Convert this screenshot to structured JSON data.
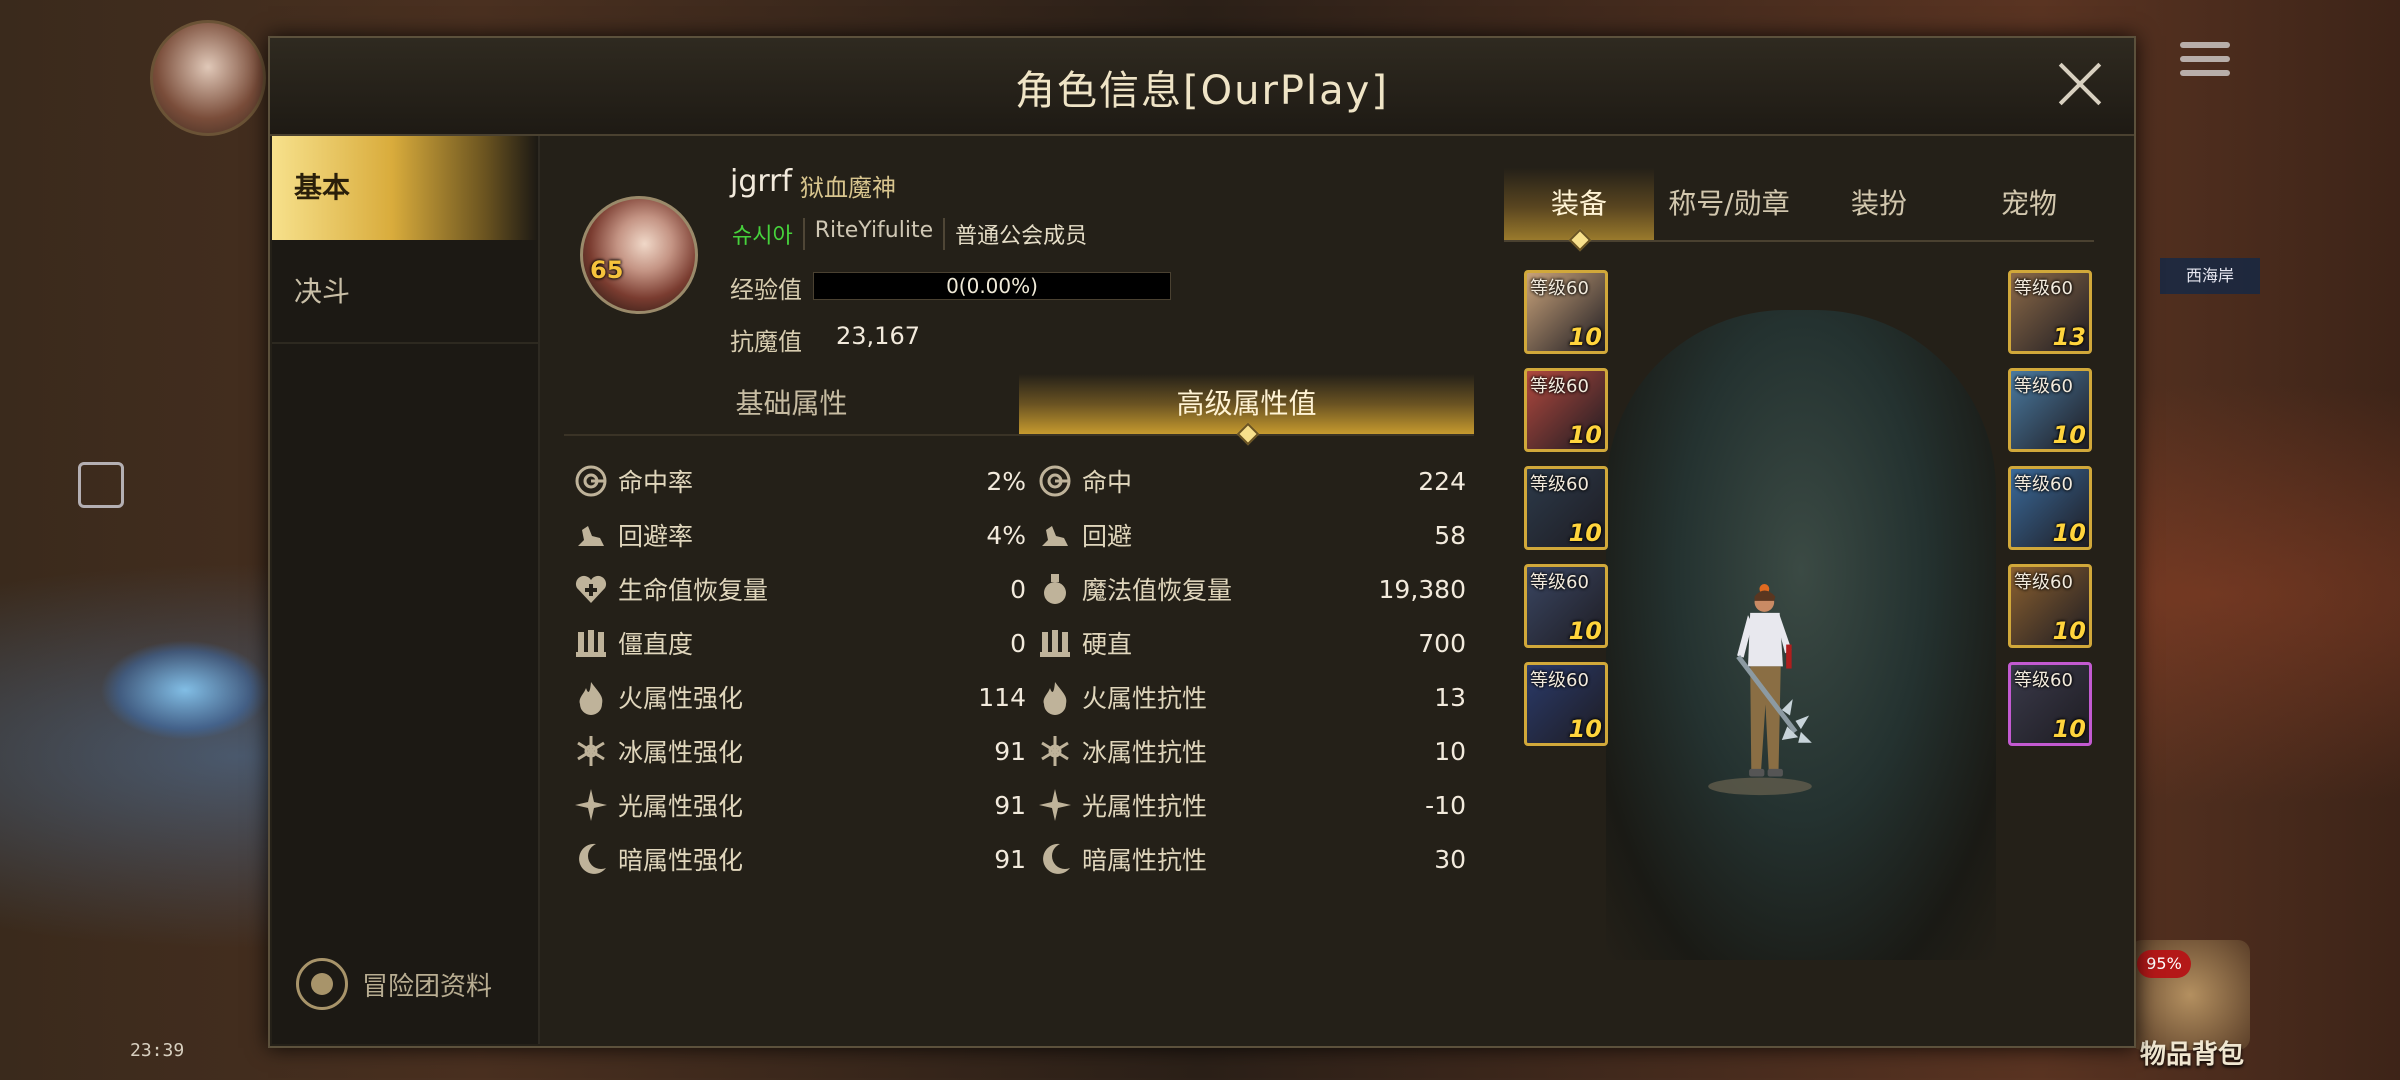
{
  "background": {
    "status_time": "23:39",
    "sidebox_label": "西海岸",
    "bag_badge": "95%",
    "bag_label": "物品背包"
  },
  "window": {
    "title": "角色信息[OurPlay]"
  },
  "nav": {
    "items": [
      {
        "label": "基本",
        "active": true
      },
      {
        "label": "决斗",
        "active": false
      }
    ],
    "adventure_label": "冒险团资料"
  },
  "character": {
    "level": "65",
    "name": "jgrrf",
    "class_name": "狱血魔神",
    "server": "슈시아",
    "guild": "RiteYifulite",
    "guild_rank": "普通公会成员",
    "exp_label": "经验值",
    "exp_value": "0(0.00%)",
    "exp_fraction": 0.0,
    "magic_resist_label": "抗魔值",
    "magic_resist_value": "23,167"
  },
  "attribute_tabs": [
    {
      "label": "基础属性",
      "active": false
    },
    {
      "label": "高级属性值",
      "active": true
    }
  ],
  "stats": [
    {
      "left": {
        "icon": "target-icon",
        "label": "命中率",
        "value": "2%"
      },
      "right": {
        "icon": "target-icon",
        "label": "命中",
        "value": "224"
      }
    },
    {
      "left": {
        "icon": "dodge-icon",
        "label": "回避率",
        "value": "4%"
      },
      "right": {
        "icon": "dodge-icon",
        "label": "回避",
        "value": "58"
      }
    },
    {
      "left": {
        "icon": "heart-icon",
        "label": "生命值恢复量",
        "value": "0"
      },
      "right": {
        "icon": "potion-icon",
        "label": "魔法值恢复量",
        "value": "19,380"
      }
    },
    {
      "left": {
        "icon": "stiff-icon",
        "label": "僵直度",
        "value": "0"
      },
      "right": {
        "icon": "stiff-icon",
        "label": "硬直",
        "value": "700"
      }
    },
    {
      "left": {
        "icon": "fire-icon",
        "label": "火属性强化",
        "value": "114"
      },
      "right": {
        "icon": "fire-icon",
        "label": "火属性抗性",
        "value": "13"
      }
    },
    {
      "left": {
        "icon": "snowflake-icon",
        "label": "冰属性强化",
        "value": "91"
      },
      "right": {
        "icon": "snowflake-icon",
        "label": "冰属性抗性",
        "value": "10"
      }
    },
    {
      "left": {
        "icon": "light-icon",
        "label": "光属性强化",
        "value": "91"
      },
      "right": {
        "icon": "light-icon",
        "label": "光属性抗性",
        "value": "-10"
      }
    },
    {
      "left": {
        "icon": "moon-icon",
        "label": "暗属性强化",
        "value": "91"
      },
      "right": {
        "icon": "moon-icon",
        "label": "暗属性抗性",
        "value": "30"
      }
    }
  ],
  "equipment_tabs": [
    {
      "label": "装备",
      "active": true
    },
    {
      "label": "称号/勋章",
      "active": false
    },
    {
      "label": "装扮",
      "active": false
    },
    {
      "label": "宠物",
      "active": false
    }
  ],
  "equipment_left": [
    {
      "level": "等级60",
      "enhance": "10"
    },
    {
      "level": "等级60",
      "enhance": "10"
    },
    {
      "level": "等级60",
      "enhance": "10"
    },
    {
      "level": "等级60",
      "enhance": "10"
    },
    {
      "level": "等级60",
      "enhance": "10"
    }
  ],
  "equipment_right": [
    {
      "level": "等级60",
      "enhance": "13"
    },
    {
      "level": "等级60",
      "enhance": "10"
    },
    {
      "level": "等级60",
      "enhance": "10"
    },
    {
      "level": "等级60",
      "enhance": "10"
    },
    {
      "level": "等级60",
      "enhance": "10"
    }
  ],
  "colors": {
    "accent_gold": "#d9ac3c",
    "server_green": "#46d23c",
    "enhance_yellow": "#ffd43c",
    "slot_purple": "#c35ad1"
  }
}
